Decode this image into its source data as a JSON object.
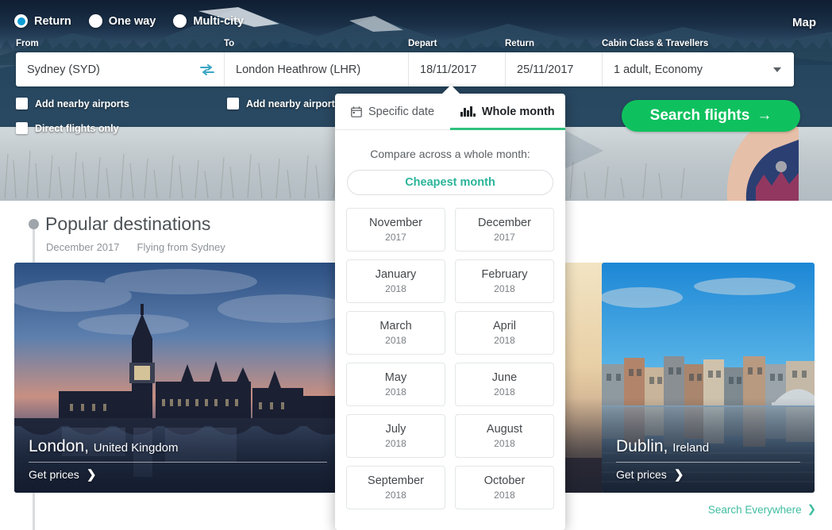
{
  "colors": {
    "accent_green": "#0fc15e",
    "tab_underline": "#2fc27e",
    "teal_link": "#2bb49a",
    "search_everywhere": "#3fbda0",
    "radio_selected": "#0c9dd6",
    "swap_icon": "#3aa6c4"
  },
  "header": {
    "trip_types": [
      {
        "label": "Return",
        "selected": true
      },
      {
        "label": "One way",
        "selected": false
      },
      {
        "label": "Multi-city",
        "selected": false
      }
    ],
    "map_link": "Map"
  },
  "form": {
    "labels": {
      "from": "From",
      "to": "To",
      "depart": "Depart",
      "return": "Return",
      "cabin": "Cabin Class & Travellers"
    },
    "values": {
      "from": "Sydney (SYD)",
      "to": "London Heathrow (LHR)",
      "depart": "18/11/2017",
      "return": "25/11/2017",
      "cabin": "1 adult, Economy"
    },
    "checkboxes": [
      {
        "label": "Add nearby airports",
        "checked": false
      },
      {
        "label": "Add nearby airports",
        "checked": false
      },
      {
        "label": "Direct flights only",
        "checked": false
      }
    ],
    "search_button": "Search flights",
    "search_button_arrow": "→"
  },
  "date_panel": {
    "tabs": [
      {
        "label": "Specific date",
        "icon": "calendar-icon",
        "active": false
      },
      {
        "label": "Whole month",
        "icon": "bar-chart-icon",
        "active": true
      }
    ],
    "subtitle": "Compare across a whole month:",
    "cheapest_button": "Cheapest month",
    "months": [
      {
        "name": "November",
        "year": "2017"
      },
      {
        "name": "December",
        "year": "2017"
      },
      {
        "name": "January",
        "year": "2018"
      },
      {
        "name": "February",
        "year": "2018"
      },
      {
        "name": "March",
        "year": "2018"
      },
      {
        "name": "April",
        "year": "2018"
      },
      {
        "name": "May",
        "year": "2018"
      },
      {
        "name": "June",
        "year": "2018"
      },
      {
        "name": "July",
        "year": "2018"
      },
      {
        "name": "August",
        "year": "2018"
      },
      {
        "name": "September",
        "year": "2018"
      },
      {
        "name": "October",
        "year": "2018"
      }
    ]
  },
  "popular": {
    "title": "Popular destinations",
    "month": "December 2017",
    "origin": "Flying from Sydney",
    "cards": [
      {
        "city": "London,",
        "country": "United Kingdom",
        "cta": "Get prices",
        "chevron": "❯"
      },
      {
        "city": "",
        "country": "",
        "cta": "",
        "chevron": ""
      },
      {
        "city": "Dublin,",
        "country": "Ireland",
        "cta": "Get prices",
        "chevron": "❯"
      }
    ],
    "search_everywhere": "Search Everywhere",
    "search_everywhere_chevron": "❯"
  }
}
